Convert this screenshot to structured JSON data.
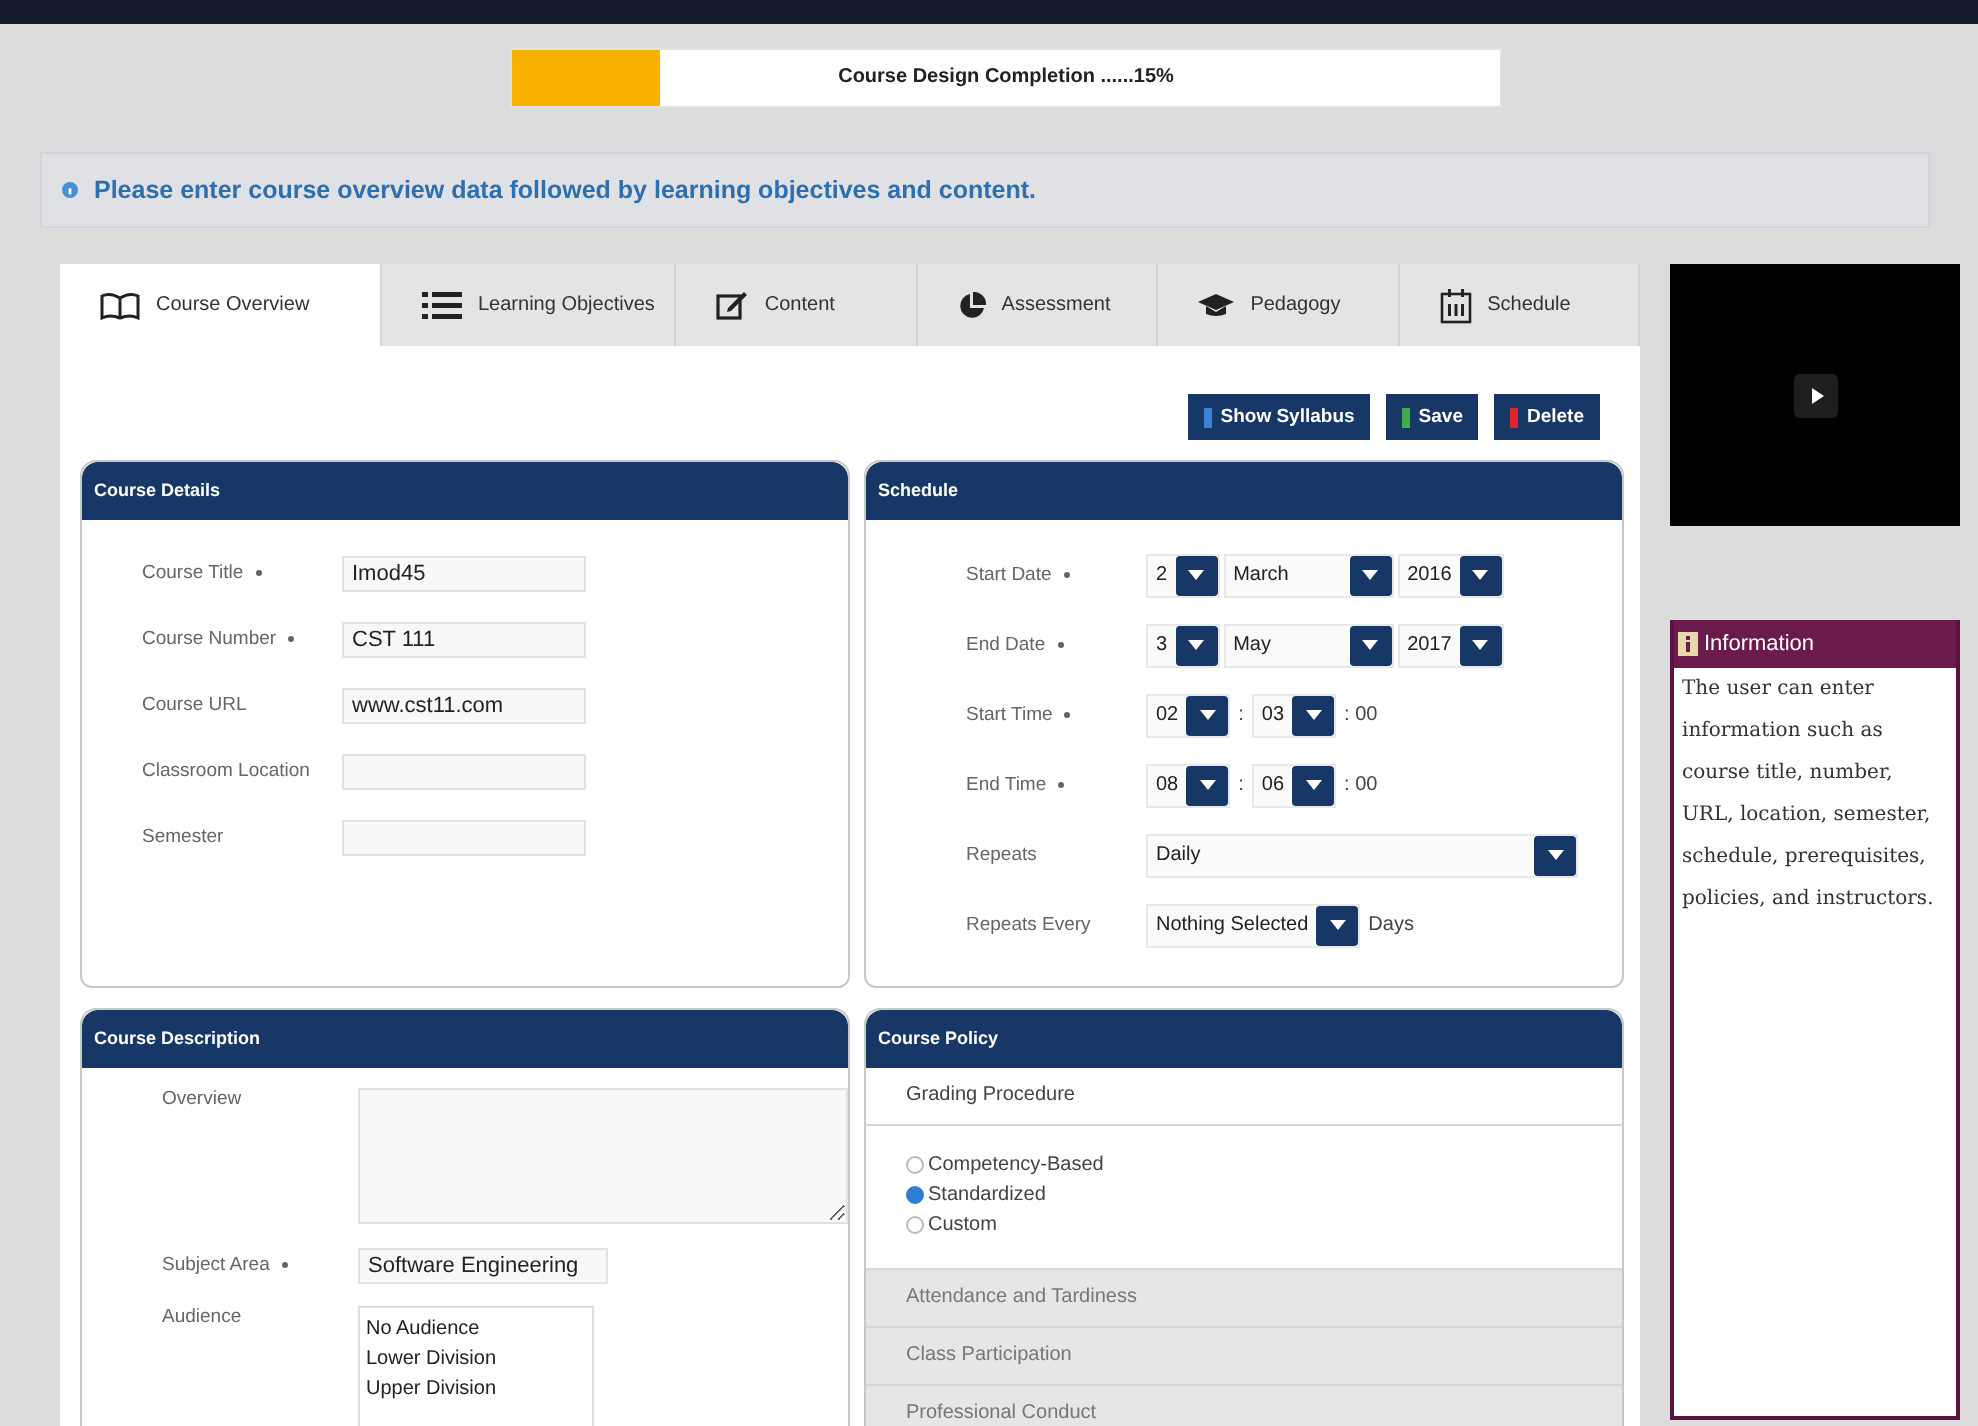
{
  "progress": {
    "label": "Course Design Completion ......15%",
    "level": 0.15
  },
  "notice": "Please enter course overview data followed by learning objectives and content.",
  "tabs": [
    {
      "label": "Course Overview",
      "kind": "book",
      "selected": true
    },
    {
      "label": "Learning Objectives",
      "kind": "list",
      "selected": false
    },
    {
      "label": "Content",
      "kind": "edit",
      "selected": false
    },
    {
      "label": "Assessment",
      "kind": "pie",
      "selected": false
    },
    {
      "label": "Pedagogy",
      "kind": "cap",
      "selected": false
    },
    {
      "label": "Schedule",
      "kind": "calendar",
      "selected": false
    }
  ],
  "actions": [
    {
      "label": "Show Syllabus",
      "color": "#3b82d6"
    },
    {
      "label": "Save",
      "color": "#3fae49"
    },
    {
      "label": "Delete",
      "color": "#e0242b"
    }
  ],
  "course_details": {
    "title": "Course Details",
    "fields": [
      {
        "label": "Course Title",
        "required": true,
        "value": "Imod45"
      },
      {
        "label": "Course Number",
        "required": true,
        "value": "CST 111"
      },
      {
        "label": "Course URL",
        "required": false,
        "value": "www.cst11.com"
      },
      {
        "label": "Classroom Location",
        "required": false
      },
      {
        "label": "Semester",
        "required": false
      }
    ]
  },
  "schedule": {
    "title": "Schedule",
    "rows": [
      {
        "label": "Start Date",
        "required": true,
        "parts": [
          {
            "kind": "select",
            "value": "2"
          },
          {
            "kind": "month-select",
            "value": "March"
          },
          {
            "kind": "select",
            "value": "2016"
          }
        ]
      },
      {
        "label": "End Date",
        "required": true,
        "parts": [
          {
            "kind": "select",
            "value": "3"
          },
          {
            "kind": "month-select",
            "value": "May"
          },
          {
            "kind": "select",
            "value": "2017"
          }
        ]
      },
      {
        "label": "Start Time",
        "required": true,
        "parts": [
          {
            "kind": "select",
            "value": "02"
          },
          {
            "kind": "text",
            "value": ":"
          },
          {
            "kind": "select",
            "value": "03"
          },
          {
            "kind": "text",
            "value": ": 00"
          }
        ]
      },
      {
        "label": "End Time",
        "required": true,
        "parts": [
          {
            "kind": "select",
            "value": "08"
          },
          {
            "kind": "text",
            "value": ":"
          },
          {
            "kind": "select",
            "value": "06"
          },
          {
            "kind": "text",
            "value": ": 00"
          }
        ]
      },
      {
        "label": "Repeats",
        "required": false,
        "parts": [
          {
            "kind": "wide-select",
            "value": "Daily"
          }
        ]
      },
      {
        "label": "Repeats Every",
        "required": false,
        "parts": [
          {
            "kind": "select",
            "value": "Nothing Selected"
          },
          {
            "kind": "text",
            "value": "Days"
          }
        ]
      }
    ]
  },
  "course_description": {
    "title": "Course Description",
    "overview_label": "Overview",
    "subject_area": {
      "label": "Subject Area",
      "required": true,
      "value": "Software Engineering"
    },
    "audience": {
      "label": "Audience",
      "options": [
        "No Audience",
        "Lower Division",
        "Upper Division"
      ]
    }
  },
  "course_policy": {
    "title": "Course Policy",
    "sections": [
      {
        "label": "Grading Procedure",
        "expanded": true,
        "options": [
          {
            "label": "Competency-Based",
            "selected": false
          },
          {
            "label": "Standardized",
            "selected": true
          },
          {
            "label": "Custom",
            "selected": false
          }
        ]
      },
      {
        "label": "Attendance and Tardiness",
        "expanded": false
      },
      {
        "label": "Class Participation",
        "expanded": false
      },
      {
        "label": "Professional Conduct",
        "expanded": false
      }
    ]
  },
  "information": {
    "title": "Information",
    "text": "The user can enter information such as course title, number, URL, location, semester, schedule, prerequisites, policies, and instructors."
  }
}
